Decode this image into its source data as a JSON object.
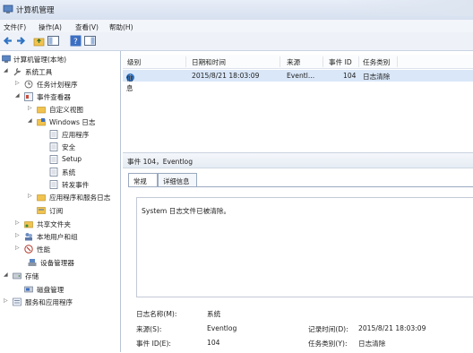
{
  "window": {
    "title": "计算机管理"
  },
  "menu": [
    "文件(F)",
    "操作(A)",
    "查看(V)",
    "帮助(H)"
  ],
  "tree": {
    "root": "计算机管理(本地)",
    "system_tools": "系统工具",
    "task_scheduler": "任务计划程序",
    "event_viewer": "事件查看器",
    "custom_views": "自定义视图",
    "windows_logs": "Windows 日志",
    "application": "应用程序",
    "security": "安全",
    "setup": "Setup",
    "system": "系统",
    "forwarded": "转发事件",
    "app_services_logs": "应用程序和服务日志",
    "subscriptions": "订阅",
    "shared_folders": "共享文件夹",
    "local_users": "本地用户和组",
    "performance": "性能",
    "device_manager": "设备管理器",
    "storage": "存储",
    "disk_management": "磁盘管理",
    "services_apps": "服务和应用程序"
  },
  "list": {
    "columns": [
      "级别",
      "日期和时间",
      "来源",
      "事件 ID",
      "任务类别"
    ],
    "rows": [
      {
        "level": "信息",
        "datetime": "2015/8/21 18:03:09",
        "source": "Eventl...",
        "event_id": "104",
        "category": "日志清除"
      }
    ]
  },
  "event": {
    "header": "事件 104，Eventlog",
    "tabs": [
      "常规",
      "详细信息"
    ],
    "message": "System 日志文件已被清除。",
    "log_name_label": "日志名称(M):",
    "log_name": "系统",
    "source_label": "来源(S):",
    "source": "Eventlog",
    "logged_label": "记录时间(D):",
    "logged": "2015/8/21 18:03:09",
    "event_id_label": "事件 ID(E):",
    "event_id": "104",
    "category_label": "任务类别(Y):",
    "category": "日志清除"
  },
  "colors": {
    "selection": "#d9e7f8",
    "info_icon": "#2f74c7"
  }
}
